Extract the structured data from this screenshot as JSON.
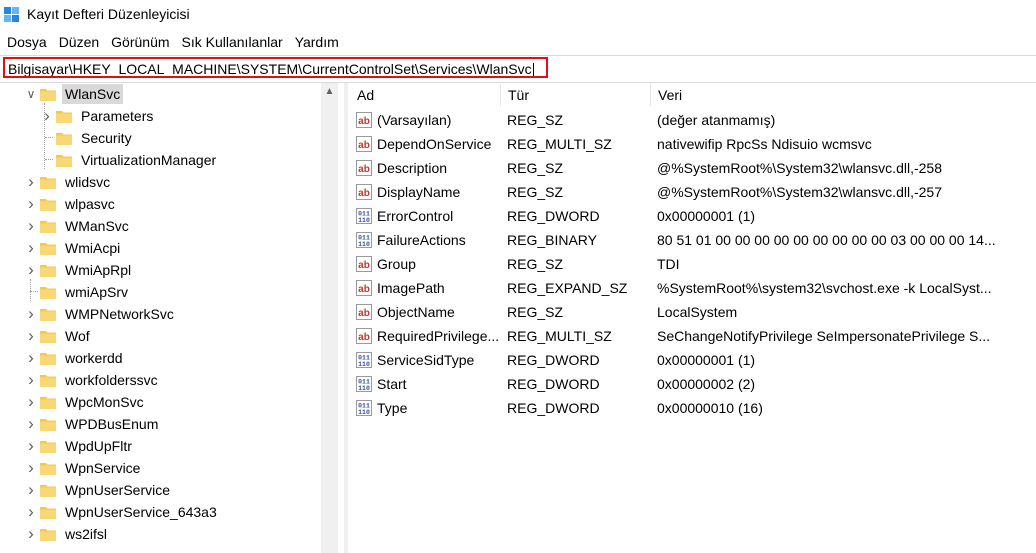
{
  "window": {
    "title": "Kayıt Defteri Düzenleyicisi"
  },
  "menu": [
    "Dosya",
    "Düzen",
    "Görünüm",
    "Sık Kullanılanlar",
    "Yardım"
  ],
  "address": {
    "path": "Bilgisayar\\HKEY_LOCAL_MACHINE\\SYSTEM\\CurrentControlSet\\Services\\WlanSvc"
  },
  "tree": {
    "selected": "WlanSvc",
    "children": [
      "Parameters",
      "Security",
      "VirtualizationManager"
    ],
    "siblings": [
      "wlidsvc",
      "wlpasvc",
      "WManSvc",
      "WmiAcpi",
      "WmiApRpl",
      "wmiApSrv",
      "WMPNetworkSvc",
      "Wof",
      "workerdd",
      "workfolderssvc",
      "WpcMonSvc",
      "WPDBusEnum",
      "WpdUpFltr",
      "WpnService",
      "WpnUserService",
      "WpnUserService_643a3",
      "ws2ifsl"
    ]
  },
  "list": {
    "columns": [
      "Ad",
      "Tür",
      "Veri"
    ],
    "rows": [
      {
        "icon": "string-value-icon",
        "name": "(Varsayılan)",
        "type": "REG_SZ",
        "data": "(değer atanmamış)"
      },
      {
        "icon": "string-value-icon",
        "name": "DependOnService",
        "type": "REG_MULTI_SZ",
        "data": "nativewifip RpcSs Ndisuio wcmsvc"
      },
      {
        "icon": "string-value-icon",
        "name": "Description",
        "type": "REG_SZ",
        "data": "@%SystemRoot%\\System32\\wlansvc.dll,-258"
      },
      {
        "icon": "string-value-icon",
        "name": "DisplayName",
        "type": "REG_SZ",
        "data": "@%SystemRoot%\\System32\\wlansvc.dll,-257"
      },
      {
        "icon": "binary-value-icon",
        "name": "ErrorControl",
        "type": "REG_DWORD",
        "data": "0x00000001 (1)"
      },
      {
        "icon": "binary-value-icon",
        "name": "FailureActions",
        "type": "REG_BINARY",
        "data": "80 51 01 00 00 00 00 00 00 00 00 00 03 00 00 00 14..."
      },
      {
        "icon": "string-value-icon",
        "name": "Group",
        "type": "REG_SZ",
        "data": "TDI"
      },
      {
        "icon": "string-value-icon",
        "name": "ImagePath",
        "type": "REG_EXPAND_SZ",
        "data": "%SystemRoot%\\system32\\svchost.exe -k LocalSyst..."
      },
      {
        "icon": "string-value-icon",
        "name": "ObjectName",
        "type": "REG_SZ",
        "data": "LocalSystem"
      },
      {
        "icon": "string-value-icon",
        "name": "RequiredPrivilege...",
        "type": "REG_MULTI_SZ",
        "data": "SeChangeNotifyPrivilege SeImpersonatePrivilege S..."
      },
      {
        "icon": "binary-value-icon",
        "name": "ServiceSidType",
        "type": "REG_DWORD",
        "data": "0x00000001 (1)"
      },
      {
        "icon": "binary-value-icon",
        "name": "Start",
        "type": "REG_DWORD",
        "data": "0x00000002 (2)"
      },
      {
        "icon": "binary-value-icon",
        "name": "Type",
        "type": "REG_DWORD",
        "data": "0x00000010 (16)"
      }
    ]
  },
  "colors": {
    "highlight_border": "#e01010",
    "selection": "#d9d9d9",
    "folder": "#f3c94b",
    "string_icon": "#c0392b",
    "binary_icon": "#2b4fa0"
  }
}
